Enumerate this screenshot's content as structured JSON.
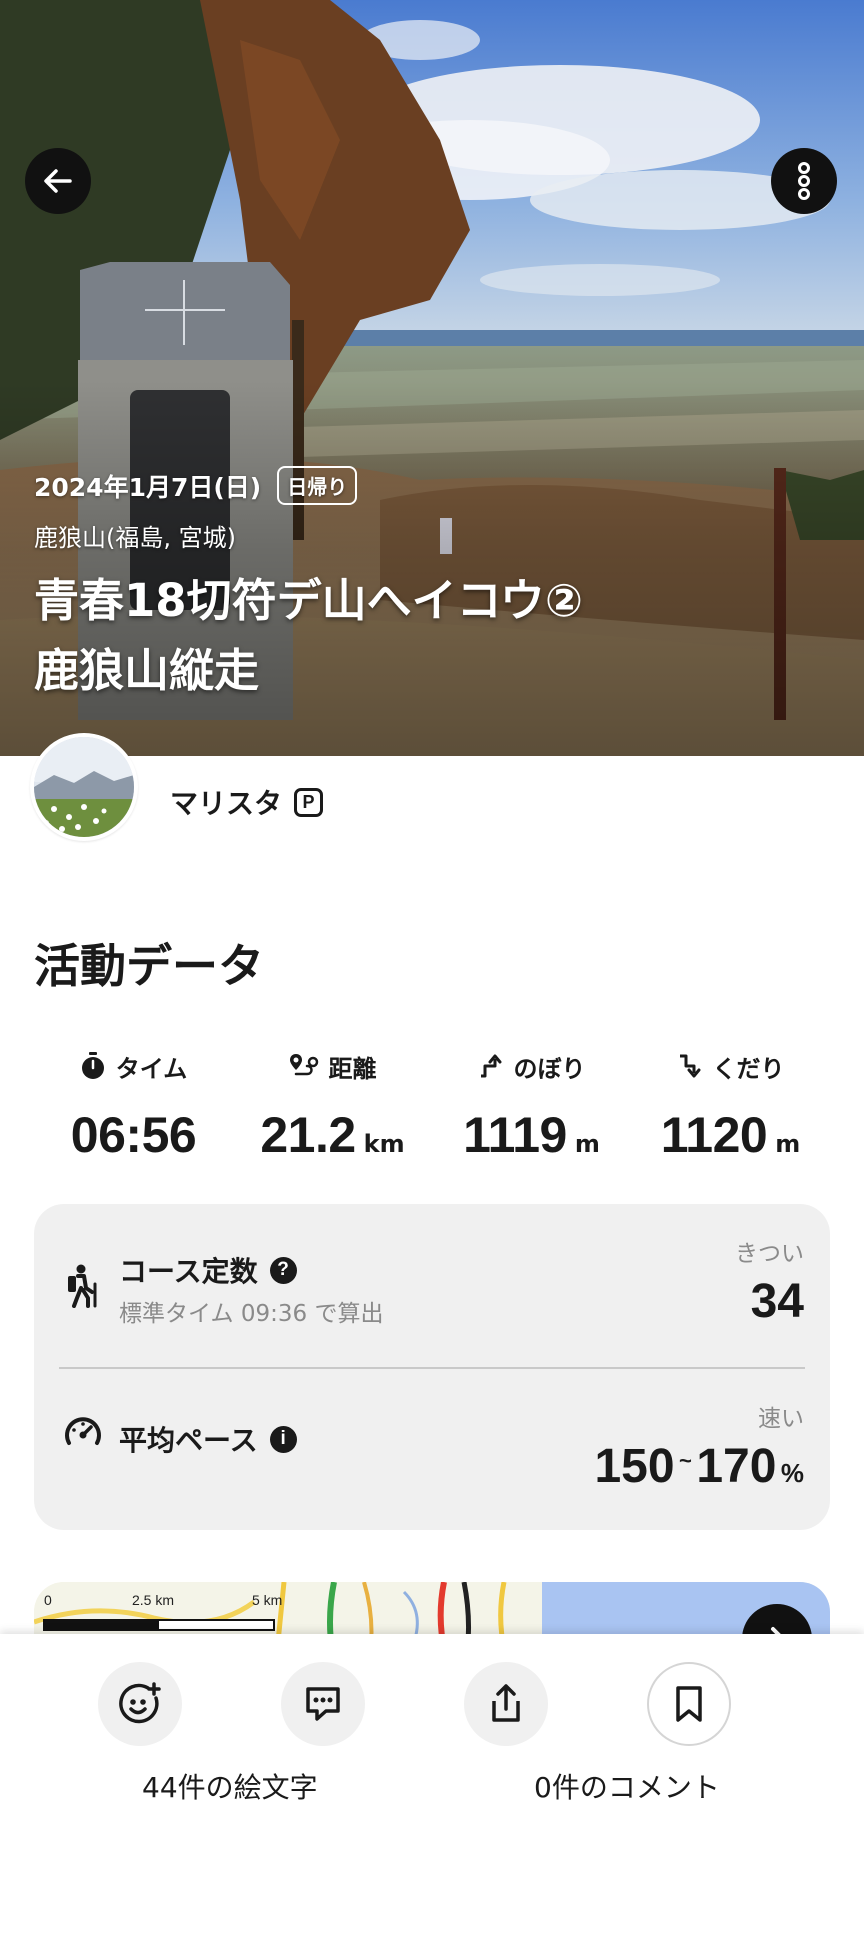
{
  "hero": {
    "date": "2024年1月7日(日)",
    "badge": "日帰り",
    "location": "鹿狼山(福島, 宮城)",
    "title_line1": "青春18切符デ山へイコウ②",
    "title_line2": "鹿狼山縦走",
    "back_icon": "arrow-left-icon",
    "more_icon": "more-vertical-icon"
  },
  "user": {
    "name": "マリスタ",
    "premium_badge": "P"
  },
  "activity": {
    "section_title": "活動データ",
    "stats": [
      {
        "label": "タイム",
        "value": "06:56",
        "unit": "",
        "icon": "stopwatch-icon"
      },
      {
        "label": "距離",
        "value": "21.2",
        "unit": "km",
        "icon": "route-icon"
      },
      {
        "label": "のぼり",
        "value": "1119",
        "unit": "m",
        "icon": "ascent-icon"
      },
      {
        "label": "くだり",
        "value": "1120",
        "unit": "m",
        "icon": "descent-icon"
      }
    ],
    "course": {
      "title": "コース定数",
      "help": "?",
      "subtitle": "標準タイム 09:36 で算出",
      "tag": "きつい",
      "value": "34"
    },
    "pace": {
      "title": "平均ペース",
      "info": "i",
      "tag": "速い",
      "min": "150",
      "sep": "~",
      "max": "170",
      "unit": "%"
    }
  },
  "map": {
    "scale_0": "0",
    "scale_mid": "2.5 km",
    "scale_end": "5 km"
  },
  "bottom_bar": {
    "emoji_count": "44件の絵文字",
    "comment_count": "0件のコメント"
  },
  "colors": {
    "card_bg": "#f0f0f0",
    "text_primary": "#1a1a1a",
    "text_muted": "#8a8a8a",
    "button_dark": "#111111"
  }
}
